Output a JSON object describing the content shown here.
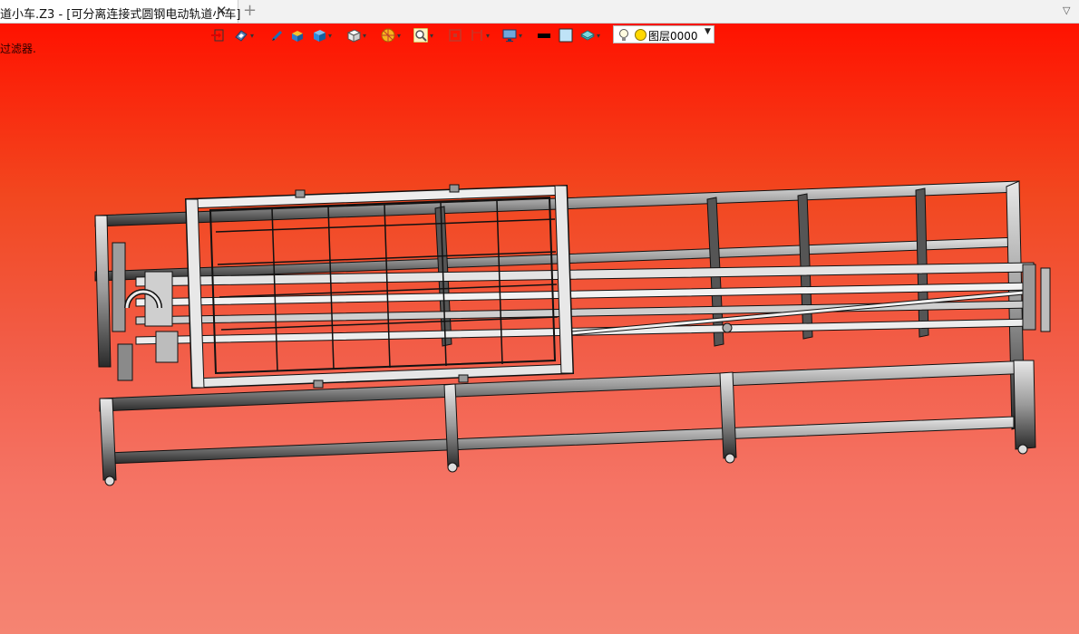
{
  "tab": {
    "title": "道小车.Z3 - [可分离连接式圆钢电动轨道小车]",
    "close_icon": "close-icon",
    "add_icon": "plus-icon",
    "menu_icon": "chevron-down-icon"
  },
  "status_message": "过滤器.",
  "toolbar": {
    "tools": [
      {
        "name": "exit-icon",
        "dropdown": false
      },
      {
        "name": "view-orient-icon",
        "dropdown": true
      },
      {
        "name": "pencil-icon",
        "dropdown": false
      },
      {
        "name": "shaded-cube-icon",
        "dropdown": false
      },
      {
        "name": "blue-cube-icon",
        "dropdown": true
      },
      {
        "name": "white-cube-icon",
        "dropdown": true
      },
      {
        "name": "section-wheel-icon",
        "dropdown": true
      },
      {
        "name": "zoom-icon",
        "dropdown": true
      },
      {
        "name": "fit-frame-icon",
        "dropdown": false
      },
      {
        "name": "dimension-icon",
        "dropdown": true
      },
      {
        "name": "display-monitor-icon",
        "dropdown": true
      },
      {
        "name": "black-line-icon",
        "dropdown": false
      },
      {
        "name": "light-blue-square-icon",
        "dropdown": false
      },
      {
        "name": "layer-stack-icon",
        "dropdown": true
      }
    ],
    "layer_select": {
      "value": "图层0000",
      "bulb_icon": "light-bulb-icon",
      "color_icon": "yellow-circle-icon"
    }
  },
  "colors": {
    "background_top": "#ff1200",
    "background_bottom": "#f58472",
    "model_edges": "#0d0d0d",
    "model_faces": "#b8b8b8"
  }
}
